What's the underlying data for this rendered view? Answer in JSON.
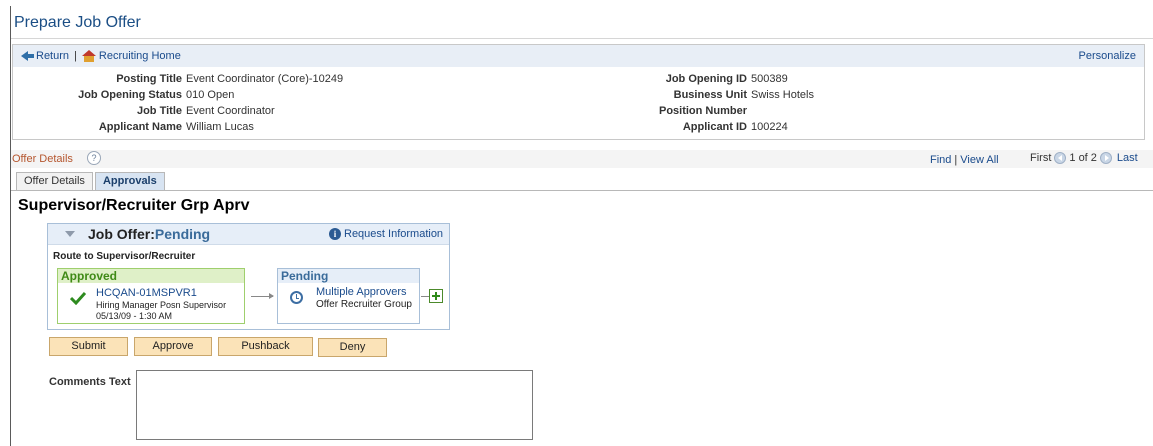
{
  "page": {
    "title": "Prepare Job Offer"
  },
  "header": {
    "return_label": "Return",
    "separator": "|",
    "recruiting_home_label": "Recruiting Home",
    "personalize_label": "Personalize",
    "left_fields": [
      {
        "label": "Posting Title",
        "value": "Event Coordinator (Core)-10249"
      },
      {
        "label": "Job Opening Status",
        "value": "010 Open"
      },
      {
        "label": "Job Title",
        "value": "Event Coordinator"
      },
      {
        "label": "Applicant Name",
        "value": "William Lucas"
      }
    ],
    "right_fields": [
      {
        "label": "Job Opening ID",
        "value": "500389"
      },
      {
        "label": "Business Unit",
        "value": "Swiss Hotels"
      },
      {
        "label": "Position Number",
        "value": ""
      },
      {
        "label": "Applicant ID",
        "value": "100224"
      }
    ]
  },
  "offer_bar": {
    "title": "Offer Details",
    "help_glyph": "?",
    "find_label": "Find",
    "find_sep": "|",
    "view_all_label": "View All",
    "first_label": "First",
    "page_indicator": "1 of 2",
    "last_label": "Last"
  },
  "tabs": [
    {
      "label": "Offer Details",
      "active": false
    },
    {
      "label": "Approvals",
      "active": true
    }
  ],
  "approvals": {
    "section_title": "Supervisor/Recruiter Grp Aprv",
    "job_offer_label": "Job Offer:",
    "job_offer_status": "Pending",
    "request_info_label": "Request Information",
    "info_glyph": "i",
    "route_label": "Route to Supervisor/Recruiter",
    "approved_step": {
      "header": "Approved",
      "approver": "HCQAN-01MSPVR1",
      "role": "Hiring Manager Posn Supervisor",
      "datetime": "05/13/09 - 1:30 AM"
    },
    "pending_step": {
      "header": "Pending",
      "approver": "Multiple Approvers",
      "group": "Offer Recruiter Group"
    }
  },
  "buttons": {
    "submit": "Submit",
    "approve": "Approve",
    "pushback": "Pushback",
    "deny": "Deny"
  },
  "comments": {
    "label": "Comments Text",
    "value": ""
  },
  "colors": {
    "title_blue": "#1b4e85",
    "link_blue": "#1a4b8c",
    "offer_orange": "#b5562e",
    "approved_green": "#3f8a16",
    "button_bg": "#fbe3b8"
  },
  "icons": {
    "return": "arrow-left-icon",
    "home": "home-icon",
    "help": "help-icon",
    "pager_prev": "previous-arrow-icon",
    "pager_next": "next-arrow-icon",
    "collapse": "collapse-triangle-icon",
    "info": "info-icon",
    "approved": "checkmark-icon",
    "pending": "clock-icon",
    "add": "add-approver-icon"
  }
}
